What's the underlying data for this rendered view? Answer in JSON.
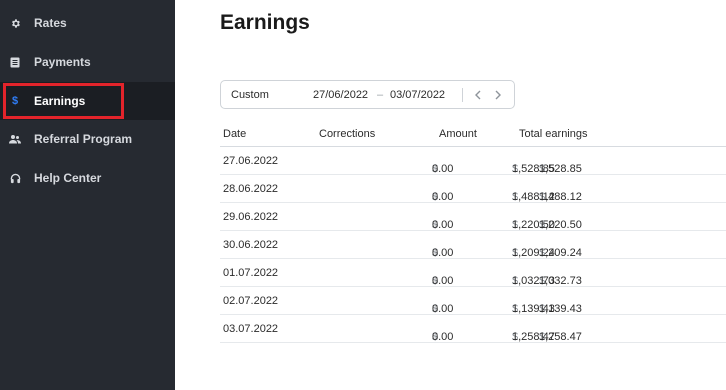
{
  "sidebar": {
    "items": [
      {
        "label": "Rates",
        "icon": "gear-icon"
      },
      {
        "label": "Payments",
        "icon": "document-icon"
      },
      {
        "label": "Earnings",
        "icon": "dollar-icon",
        "active": true
      },
      {
        "label": "Referral Program",
        "icon": "people-icon"
      },
      {
        "label": "Help Center",
        "icon": "headset-icon"
      }
    ]
  },
  "colors": {
    "sidebar_bg": "#262a31",
    "active_bg": "#1b1e23",
    "accent": "#2f7df6",
    "highlight": "#e3242b"
  },
  "main": {
    "title": "Earnings",
    "filter": {
      "preset": "Custom",
      "from": "27/06/2022",
      "separator": "–",
      "to": "03/07/2022"
    },
    "table": {
      "headers": {
        "date": "Date",
        "corrections": "Corrections",
        "amount": "Amount",
        "total": "Total earnings"
      },
      "currency": "$",
      "rows": [
        {
          "date": "27.06.2022",
          "corrections": "0.00",
          "amount": "1,528.85",
          "total": "1,528.85"
        },
        {
          "date": "28.06.2022",
          "corrections": "0.00",
          "amount": "1,488.12",
          "total": "1,488.12"
        },
        {
          "date": "29.06.2022",
          "corrections": "0.00",
          "amount": "1,220.50",
          "total": "1,220.50"
        },
        {
          "date": "30.06.2022",
          "corrections": "0.00",
          "amount": "1,209.24",
          "total": "1,209.24"
        },
        {
          "date": "01.07.2022",
          "corrections": "0.00",
          "amount": "1,032.73",
          "total": "1,032.73"
        },
        {
          "date": "02.07.2022",
          "corrections": "0.00",
          "amount": "1,139.43",
          "total": "1,139.43"
        },
        {
          "date": "03.07.2022",
          "corrections": "0.00",
          "amount": "1,258.47",
          "total": "1,258.47"
        }
      ]
    }
  }
}
